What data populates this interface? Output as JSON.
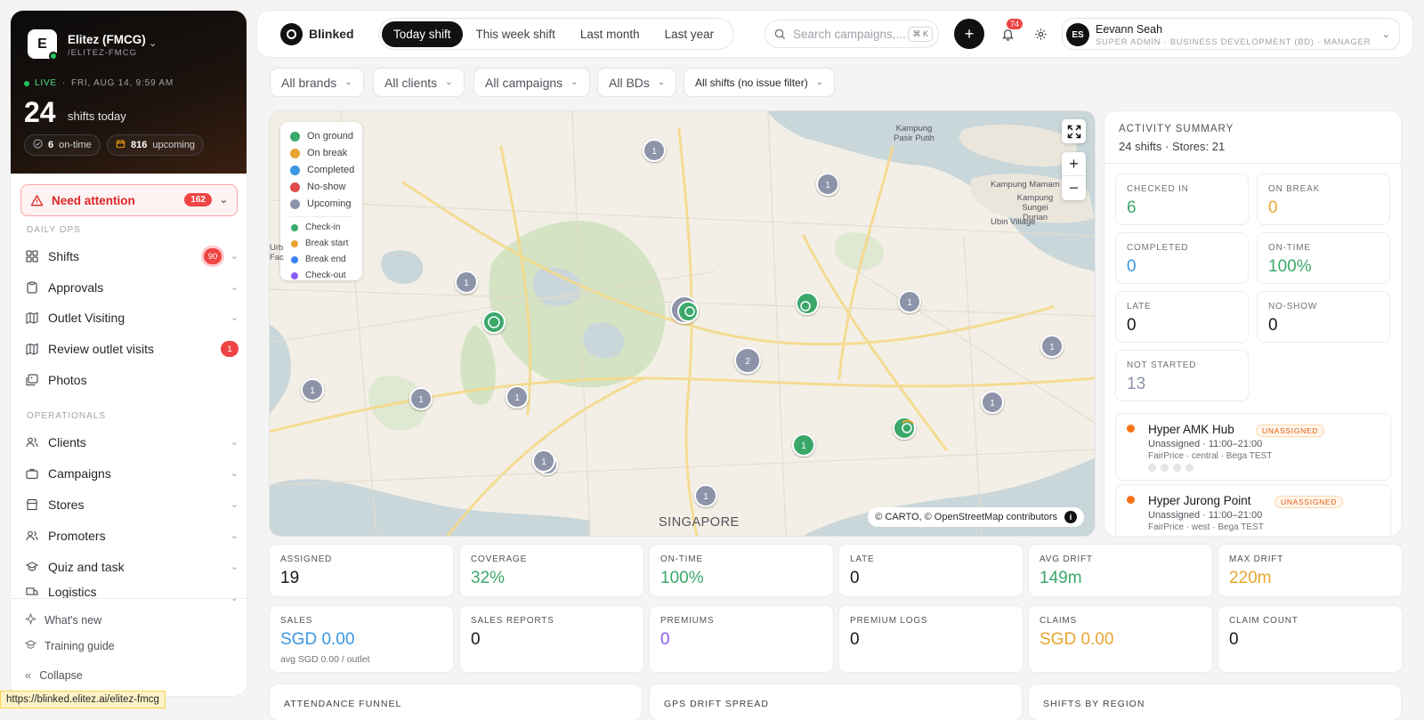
{
  "sidebar": {
    "org": {
      "initial": "E",
      "name": "Elitez (FMCG)",
      "slug": "/ELITEZ-FMCG"
    },
    "live_label": "LIVE",
    "live_time": "FRI, AUG 14, 9:59 AM",
    "shifts_count": "24",
    "shifts_label": "shifts today",
    "pills": [
      {
        "value": "6",
        "label": "on-time"
      },
      {
        "value": "816",
        "label": "upcoming"
      }
    ],
    "attention": {
      "label": "Need attention",
      "count": "162"
    },
    "sections": {
      "daily_ops": "DAILY OPS",
      "operational": "OPERATIONALS"
    },
    "items": [
      {
        "label": "Shifts",
        "badge": "90"
      },
      {
        "label": "Approvals"
      },
      {
        "label": "Outlet Visiting"
      },
      {
        "label": "Review outlet visits",
        "badge": "1"
      },
      {
        "label": "Photos"
      },
      {
        "label": "Clients"
      },
      {
        "label": "Campaigns"
      },
      {
        "label": "Stores"
      },
      {
        "label": "Promoters"
      },
      {
        "label": "Quiz and task"
      },
      {
        "label": "Logistics"
      }
    ],
    "footer": {
      "whats_new": "What's new",
      "training": "Training guide",
      "collapse": "Collapse"
    },
    "url_tooltip": "https://blinked.elitez.ai/elitez-fmcg"
  },
  "topbar": {
    "brand": "Blinked",
    "tabs": [
      "Today shift",
      "This week shift",
      "Last month",
      "Last year"
    ],
    "active_tab": 0,
    "search_placeholder": "Search campaigns,...",
    "search_kbd": "⌘ K",
    "notif_count": "74",
    "user": {
      "initials": "ES",
      "name": "Eevann Seah",
      "role": "SUPER ADMIN · BUSINESS DEVELOPMENT (BD) · MANAGER"
    }
  },
  "filters": [
    "All brands",
    "All clients",
    "All campaigns",
    "All BDs",
    "All shifts (no issue filter)"
  ],
  "map": {
    "legend_status": [
      {
        "label": "On ground",
        "color": "#3aa86b"
      },
      {
        "label": "On break",
        "color": "#e8a532"
      },
      {
        "label": "Completed",
        "color": "#3b97e3"
      },
      {
        "label": "No-show",
        "color": "#e14b4b"
      },
      {
        "label": "Upcoming",
        "color": "#8d93a8"
      }
    ],
    "legend_events": [
      {
        "label": "Check-in",
        "color": "#3aa86b"
      },
      {
        "label": "Break start",
        "color": "#e8a532"
      },
      {
        "label": "Break end",
        "color": "#3b82f6"
      },
      {
        "label": "Check-out",
        "color": "#8b5cf6"
      }
    ],
    "place_labels": [
      "Kampung Pasir Putih",
      "Kampung Mamam",
      "Kampung Sungei Durian",
      "Ubin Village",
      "Urb Fac"
    ],
    "city_label": "SINGAPORE",
    "attribution": "© CARTO, © OpenStreetMap contributors",
    "cluster_counts": [
      "1",
      "1",
      "1",
      "1",
      "1",
      "1",
      "1",
      "1",
      "1",
      "1",
      "1",
      "1",
      "2",
      "1"
    ]
  },
  "activity": {
    "title": "ACTIVITY SUMMARY",
    "subtitle": "24 shifts · Stores: 21",
    "stats": [
      {
        "label": "CHECKED IN",
        "value": "6",
        "color": "#3aa86b"
      },
      {
        "label": "ON BREAK",
        "value": "0",
        "color": "#e8a532"
      },
      {
        "label": "COMPLETED",
        "value": "0",
        "color": "#3b97e3"
      },
      {
        "label": "ON-TIME",
        "value": "100%",
        "color": "#3aa86b"
      },
      {
        "label": "LATE",
        "value": "0",
        "color": "#18181b"
      },
      {
        "label": "NO-SHOW",
        "value": "0",
        "color": "#18181b"
      },
      {
        "label": "NOT STARTED",
        "value": "13",
        "color": "#8d93a8"
      }
    ],
    "alerts": [
      {
        "name": "Hyper AMK Hub",
        "tag": "UNASSIGNED",
        "line1": "Unassigned · 11:00–21:00",
        "line2": "FairPrice · central · Bega TEST"
      },
      {
        "name": "Hyper Jurong Point",
        "tag": "UNASSIGNED",
        "line1": "Unassigned · 11:00–21:00",
        "line2": "FairPrice · west · Bega TEST"
      }
    ]
  },
  "kpis_row1": [
    {
      "label": "ASSIGNED",
      "value": "19",
      "color": "#18181b"
    },
    {
      "label": "COVERAGE",
      "value": "32%",
      "color": "#3aa86b"
    },
    {
      "label": "ON-TIME",
      "value": "100%",
      "color": "#3aa86b"
    },
    {
      "label": "LATE",
      "value": "0",
      "color": "#18181b"
    },
    {
      "label": "AVG DRIFT",
      "value": "149m",
      "color": "#3aa86b"
    },
    {
      "label": "MAX DRIFT",
      "value": "220m",
      "color": "#e8a532"
    }
  ],
  "kpis_row2": [
    {
      "label": "SALES",
      "value": "SGD 0.00",
      "sub": "avg SGD 0.00 / outlet",
      "color": "#3b97e3"
    },
    {
      "label": "SALES REPORTS",
      "value": "0",
      "color": "#18181b"
    },
    {
      "label": "PREMIUMS",
      "value": "0",
      "color": "#8b5cf6"
    },
    {
      "label": "PREMIUM LOGS",
      "value": "0",
      "color": "#18181b"
    },
    {
      "label": "CLAIMS",
      "value": "SGD 0.00",
      "color": "#e8a532"
    },
    {
      "label": "CLAIM COUNT",
      "value": "0",
      "color": "#18181b"
    }
  ],
  "bottom_cards": [
    "ATTENDANCE FUNNEL",
    "GPS DRIFT SPREAD",
    "SHIFTS BY REGION"
  ]
}
